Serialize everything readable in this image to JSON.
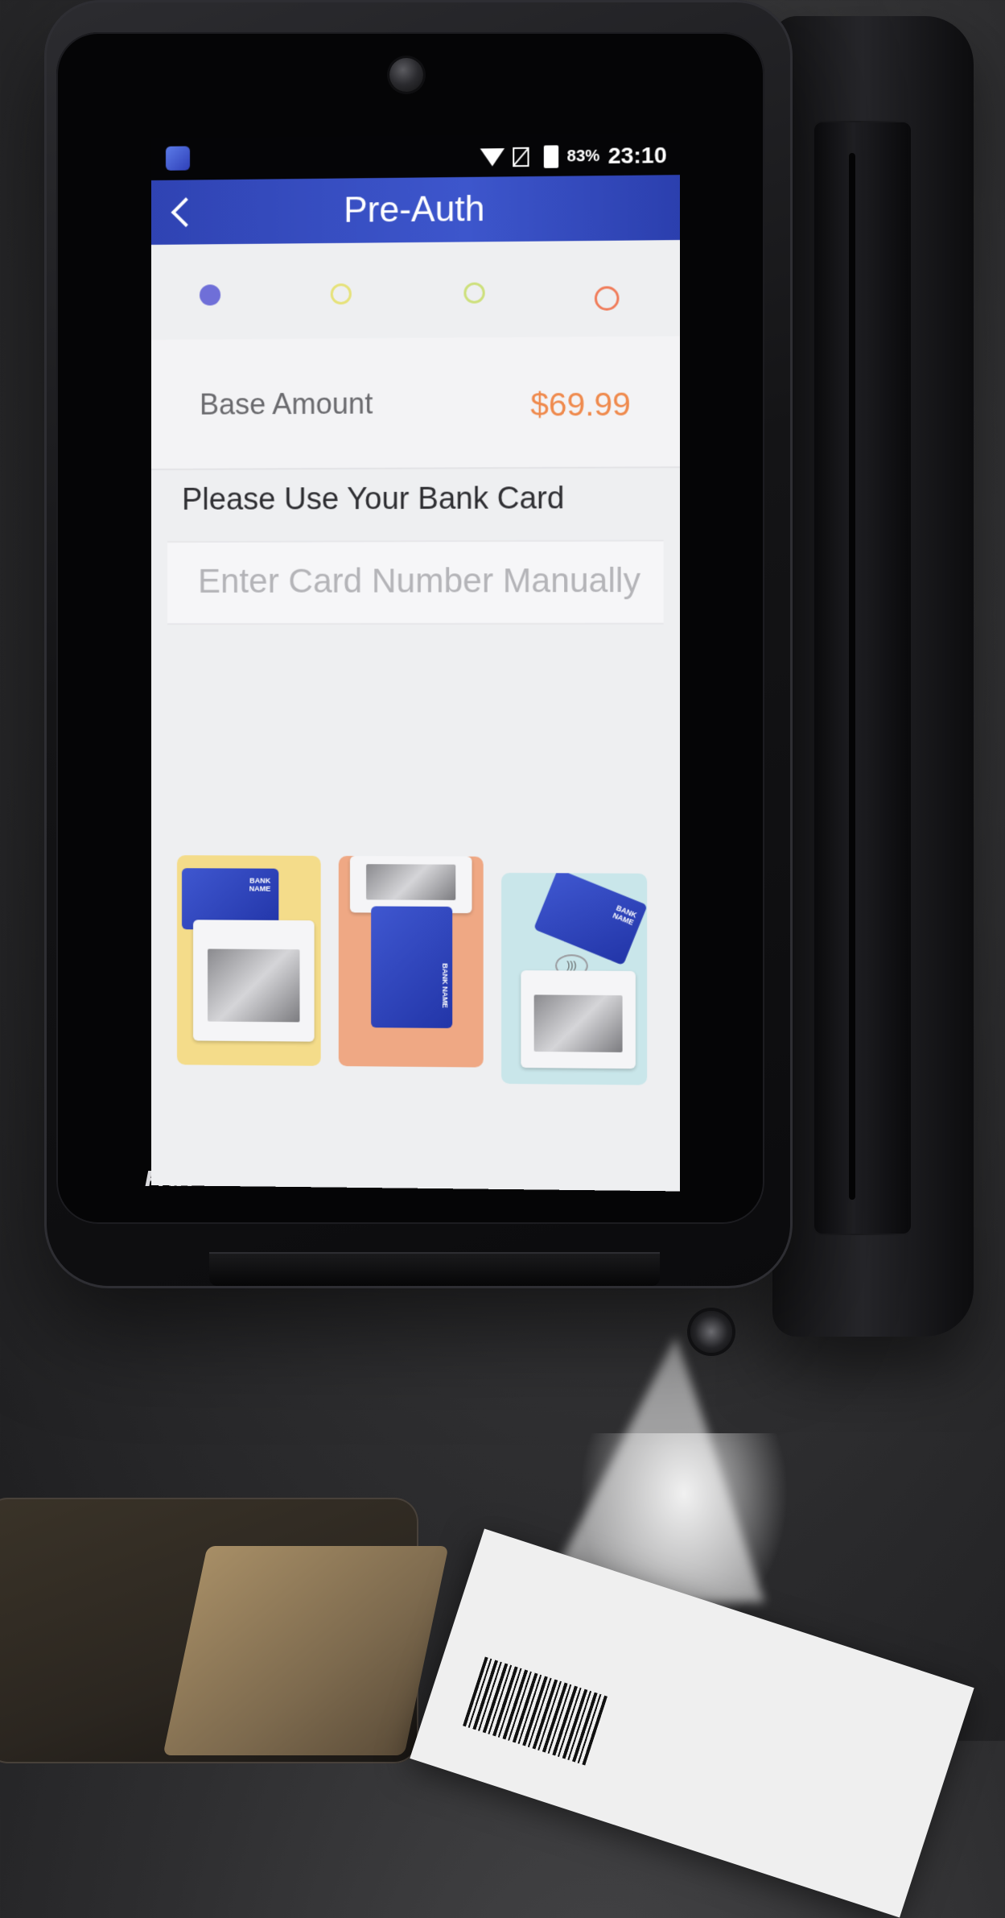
{
  "status_bar": {
    "battery": "83%",
    "time": "23:10"
  },
  "app_bar": {
    "title": "Pre-Auth"
  },
  "steps": {
    "count": 4,
    "active_index": 0,
    "colors": [
      "#6f6fd8",
      "#e6e27a",
      "#cde07c",
      "#f07c5a"
    ]
  },
  "amount": {
    "label": "Base Amount",
    "value": "$69.99"
  },
  "prompt": "Please Use Your Bank Card",
  "manual_entry": "Enter Card Number Manually",
  "card_options": [
    {
      "method": "swipe",
      "card_text": "BANK NAME",
      "bg": "#f4dc8a"
    },
    {
      "method": "insert",
      "card_text": "BANK NAME",
      "bg": "#efa884"
    },
    {
      "method": "tap",
      "card_text": "BANK NAME",
      "bg": "#c9e6ea"
    }
  ],
  "device": {
    "brand": "PAX"
  }
}
